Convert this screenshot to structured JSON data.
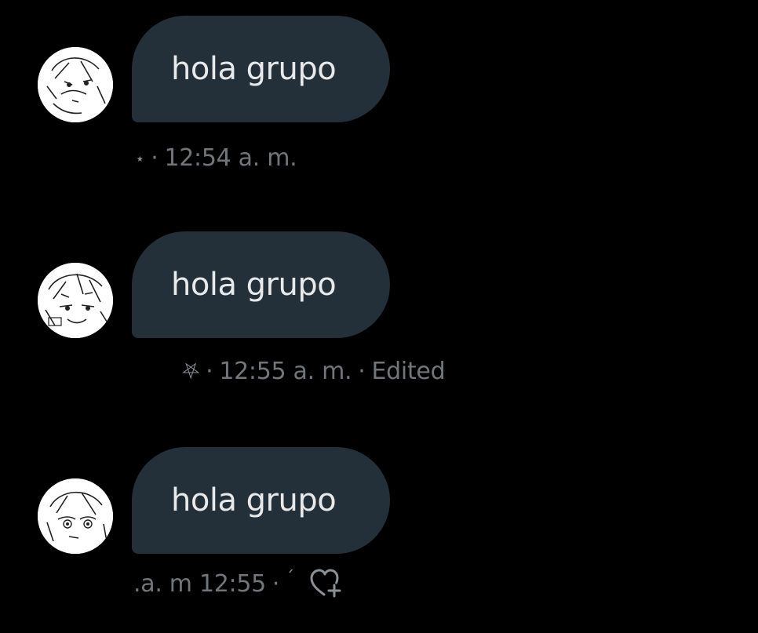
{
  "messages": [
    {
      "text": "hola grupo",
      "glyph": "⋆",
      "sep": "·",
      "time": "12:54 a. m.",
      "edited": ""
    },
    {
      "text": "hola grupo",
      "glyph": "⛧",
      "sep": "·",
      "time": "12:55 a. m.",
      "sep2": "·",
      "edited": "Edited"
    },
    {
      "text": "hola grupo",
      "time": ".a. m 12:55",
      "sep": "·",
      "glyph": "ˊ"
    }
  ],
  "icons": {
    "avatar": "avatar-image",
    "react": "heart-plus-icon"
  },
  "colors": {
    "background": "#000000",
    "bubble": "#243039",
    "bubble_text": "#e7e9ea",
    "meta_text": "#71767b"
  }
}
